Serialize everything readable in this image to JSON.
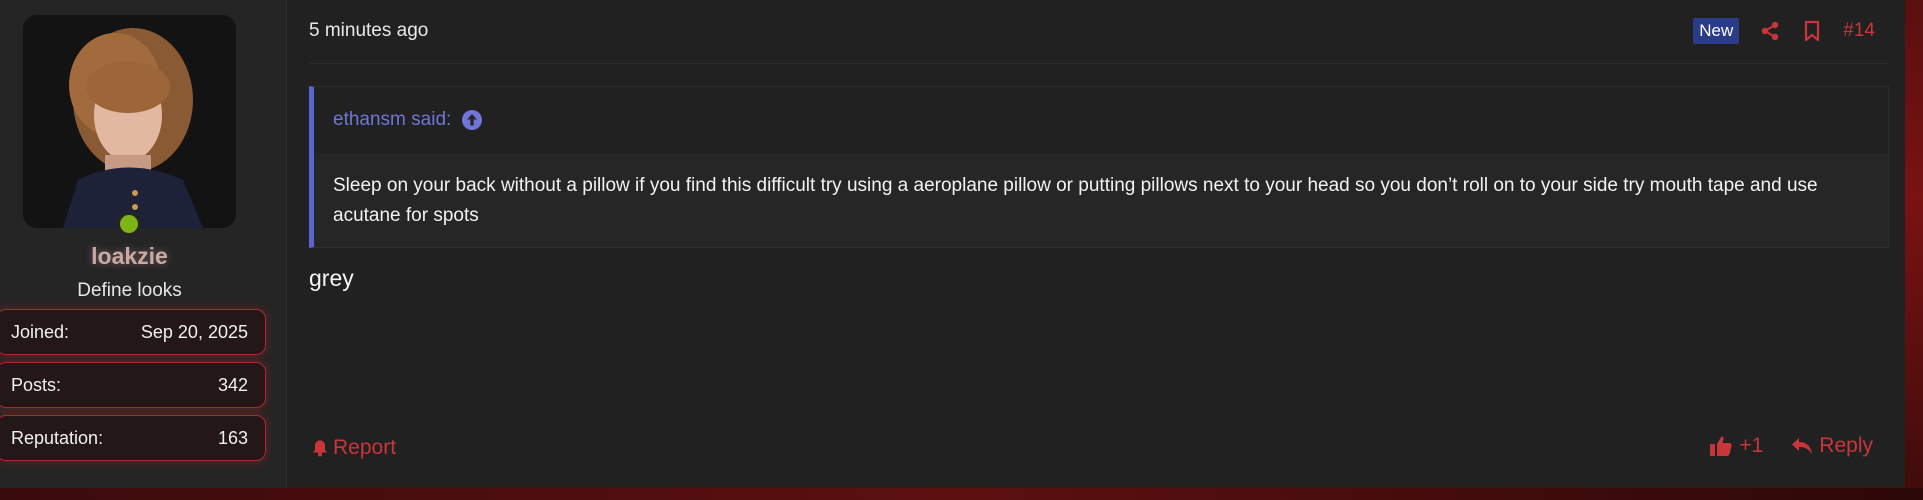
{
  "user": {
    "username": "loakzie",
    "title": "Define looks",
    "online": true,
    "stats": [
      {
        "label": "Joined:",
        "value": "Sep 20, 2025"
      },
      {
        "label": "Posts:",
        "value": "342"
      },
      {
        "label": "Reputation:",
        "value": "163"
      }
    ]
  },
  "post": {
    "time": "5 minutes ago",
    "badge": "New",
    "number": "#14",
    "quote": {
      "author": "ethansm said:",
      "text": "Sleep on your back without a pillow if you find this difficult try using a aeroplane pillow or putting pillows next to your head so you don’t roll on to your side try mouth tape and use acutane for spots"
    },
    "message": "grey",
    "actions": {
      "report": "Report",
      "like": "+1",
      "reply": "Reply"
    }
  },
  "icons": [
    "share-icon",
    "bookmark-icon",
    "arrow-up-circle-icon",
    "bell-icon",
    "thumbs-up-icon",
    "reply-icon"
  ],
  "colors": {
    "accent": "#c8353a",
    "quote_accent": "#5d63d4",
    "badge_bg": "#2a3b8a",
    "online": "#7cb518"
  }
}
